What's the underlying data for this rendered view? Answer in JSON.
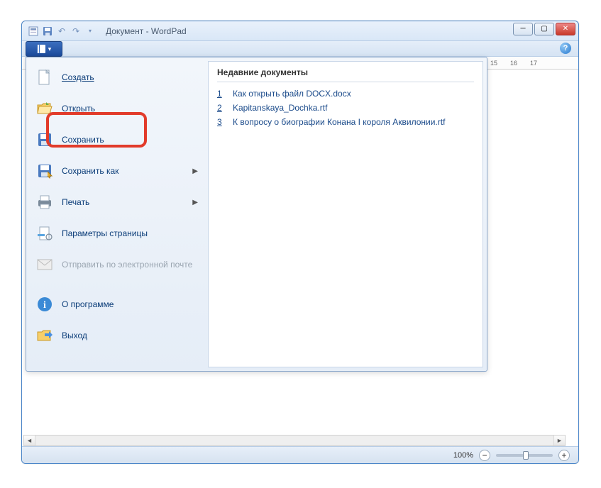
{
  "titlebar": {
    "title": "Документ - WordPad"
  },
  "ruler": {
    "mark15": "15",
    "mark16": "16",
    "mark17": "17"
  },
  "filemenu": {
    "new_label": "Создать",
    "open_label": "Открыть",
    "save_label": "Сохранить",
    "saveas_label": "Сохранить как",
    "print_label": "Печать",
    "pagesetup_label": "Параметры страницы",
    "email_label": "Отправить по электронной почте",
    "about_label": "О программе",
    "exit_label": "Выход"
  },
  "recent": {
    "heading": "Недавние документы",
    "items": [
      {
        "n": "1",
        "name": "Как открыть файл DOCX.docx"
      },
      {
        "n": "2",
        "name": "Kapitanskaya_Dochka.rtf"
      },
      {
        "n": "3",
        "name": "К вопросу о  биографии  Конана  I  короля  Аквилонии.rtf"
      }
    ]
  },
  "statusbar": {
    "zoom": "100%"
  }
}
